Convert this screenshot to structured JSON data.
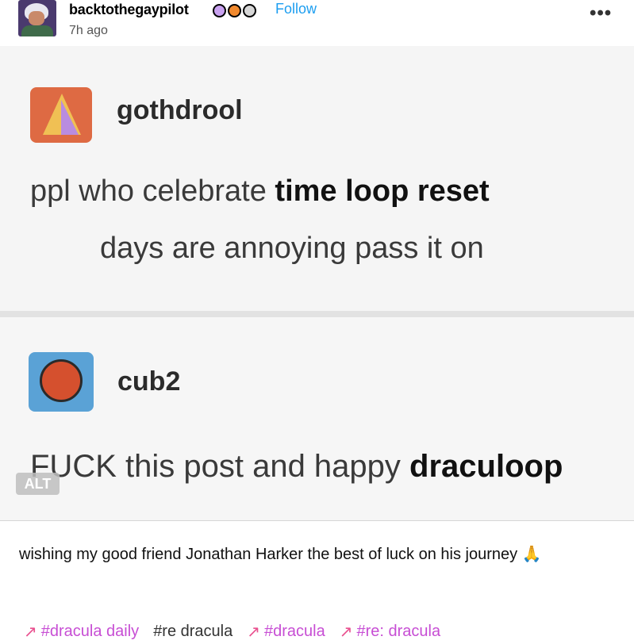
{
  "post": {
    "username": "backtothegaypilot",
    "follow_label": "Follow",
    "timestamp": "7h ago",
    "more_label": "•••",
    "badges": [
      "badge-1",
      "badge-2",
      "badge-3"
    ]
  },
  "image": {
    "original_post": {
      "username": "gothdrool",
      "text_line1_plain": "ppl who celebrate ",
      "text_line1_bold": "time loop reset",
      "text_line2": "days are annoying pass it on"
    },
    "reply": {
      "username": "cub2",
      "text_plain": "FUCK this post and happy ",
      "text_bold": "draculoop"
    },
    "alt_label": "ALT"
  },
  "caption": {
    "text": "wishing my good friend Jonathan Harker the best of luck on his journey",
    "emoji": "🙏"
  },
  "tags": [
    {
      "label": "#dracula daily",
      "trending": true
    },
    {
      "label": "#re dracula",
      "trending": false
    },
    {
      "label": "#dracula",
      "trending": true
    },
    {
      "label": "#re: dracula",
      "trending": true
    }
  ],
  "colors": {
    "follow": "#1c9ef0",
    "tag_trending": "#c74ed4",
    "trend_icon": "#e9508f"
  }
}
